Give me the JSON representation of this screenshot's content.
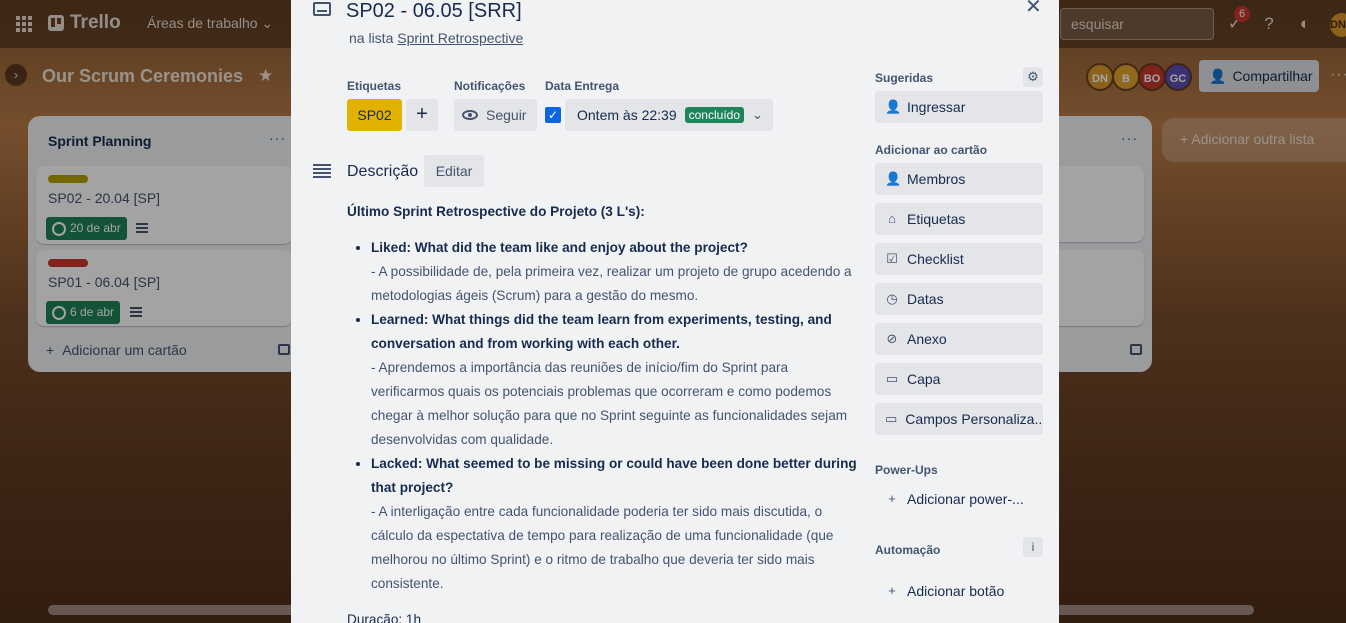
{
  "topbar": {
    "logo_text": "Trello",
    "workspaces": "Áreas de trabalho ⌄",
    "search_placeholder": "esquisar",
    "notifications_count": "6",
    "user_initials": "DN"
  },
  "board": {
    "title": "Our Scrum Ceremonies",
    "members": [
      {
        "initials": "DN",
        "color": "#d99a2b"
      },
      {
        "initials": "B",
        "color": "#e2a42c"
      },
      {
        "initials": "BO",
        "color": "#c9372c"
      },
      {
        "initials": "GC",
        "color": "#5e4db2"
      }
    ],
    "share_label": "Compartilhar",
    "add_list_label": "Adicionar outra lista"
  },
  "lists": [
    {
      "title": "Sprint Planning",
      "cards": [
        {
          "label_color": "#b5a200",
          "title": "SP02 - 20.04 [SP]",
          "date": "20 de abr"
        },
        {
          "label_color": "#c9372c",
          "title": "SP01 - 06.04 [SP]",
          "date": "6 de abr"
        }
      ],
      "add_card_label": "Adicionar um cartão"
    }
  ],
  "card": {
    "title": "SP02 - 06.05 [SRR]",
    "in_list_prefix": "na lista",
    "list_name": "Sprint Retrospective",
    "labels_heading": "Etiquetas",
    "label_text": "SP02",
    "notifications_heading": "Notificações",
    "follow_label": "Seguir",
    "due_heading": "Data Entrega",
    "due_text": "Ontem às 22:39",
    "due_status": "concluído",
    "description_heading": "Descrição",
    "edit_label": "Editar",
    "description": {
      "intro": "Último Sprint Retrospective do Projeto (3 L's):",
      "items": [
        {
          "title": "Liked: What did the team like and enjoy about the project?",
          "detail": "- A possibilidade de, pela primeira vez, realizar um projeto de grupo acedendo a metodologias ágeis (Scrum) para a gestão do mesmo."
        },
        {
          "title": "Learned: What things did the team learn from experiments, testing, and conversation and from working with each other.",
          "detail": "- Aprendemos a importância das reuniões de início/fim do Sprint para verificarmos quais os potenciais problemas que ocorreram e como podemos chegar à melhor solução para que no Sprint seguinte as funcionalidades sejam desenvolvidas com qualidade."
        },
        {
          "title": "Lacked: What seemed to be missing or could have been done better during that project?",
          "detail": "- A interligação entre cada funcionalidade poderia ter sido mais discutida, o cálculo da espectativa de tempo para realização de uma funcionalidade (que melhorou no último Sprint) e o ritmo de trabalho que deveria ter sido mais consistente."
        }
      ],
      "duration": "Duração: 1h"
    }
  },
  "sidebar": {
    "suggested_heading": "Sugeridas",
    "join_label": "Ingressar",
    "add_to_card_heading": "Adicionar ao cartão",
    "members_label": "Membros",
    "labels_label": "Etiquetas",
    "checklist_label": "Checklist",
    "dates_label": "Datas",
    "attachment_label": "Anexo",
    "cover_label": "Capa",
    "custom_fields_label": "Campos Personaliza...",
    "powerups_heading": "Power-Ups",
    "add_powerup_label": "Adicionar power-...",
    "automation_heading": "Automação",
    "add_button_label": "Adicionar botão"
  }
}
